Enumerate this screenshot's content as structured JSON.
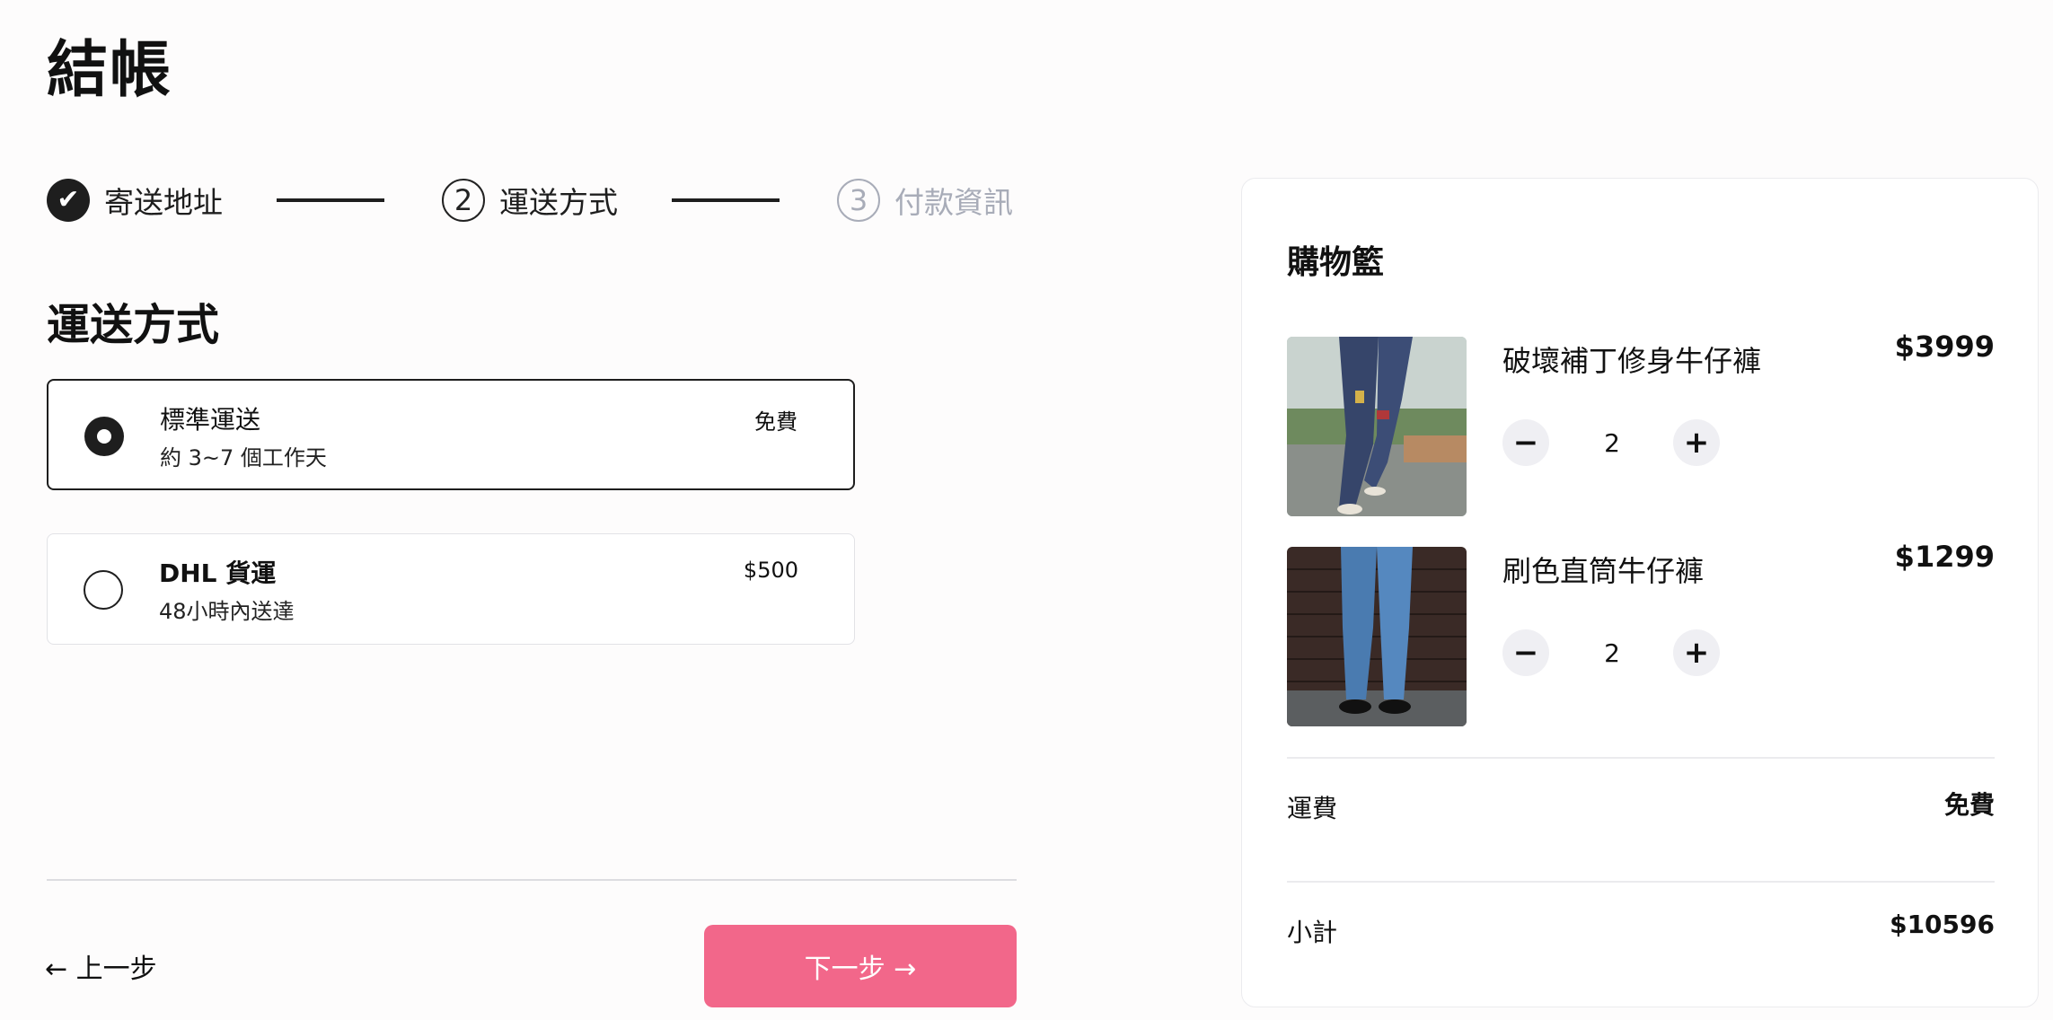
{
  "page": {
    "title": "結帳"
  },
  "stepper": {
    "steps": [
      {
        "index": "✔",
        "label": "寄送地址",
        "state": "done"
      },
      {
        "index": "2",
        "label": "運送方式",
        "state": "active"
      },
      {
        "index": "3",
        "label": "付款資訊",
        "state": "todo"
      }
    ]
  },
  "shipping": {
    "title": "運送方式",
    "options": [
      {
        "name": "標準運送",
        "desc": "約 3~7 個工作天",
        "price": "免費",
        "selected": true
      },
      {
        "name": "DHL 貨運",
        "desc": "48小時內送達",
        "price": "$500",
        "selected": false
      }
    ]
  },
  "nav": {
    "prev_label": "← 上一步",
    "next_label": "下一步 →"
  },
  "cart": {
    "title": "購物籃",
    "items": [
      {
        "name": "破壞補丁修身牛仔褲",
        "price": "$3999",
        "qty": "2",
        "image": "ripped-jeans-photo"
      },
      {
        "name": "刷色直筒牛仔褲",
        "price": "$1299",
        "qty": "2",
        "image": "washed-jeans-photo"
      }
    ],
    "shipping_label": "運費",
    "shipping_value": "免費",
    "subtotal_label": "小計",
    "subtotal_value": "$10596"
  },
  "colors": {
    "accent": "#f2678a",
    "dark": "#1e1e1e",
    "muted": "#a8acb8"
  }
}
